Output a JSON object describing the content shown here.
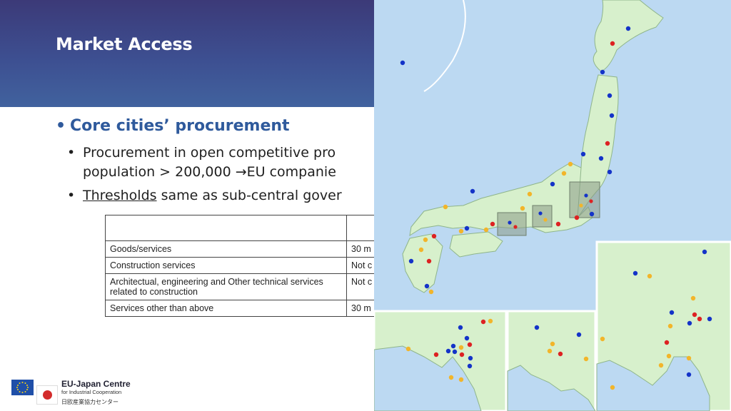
{
  "slide": {
    "title": "Market Access"
  },
  "bullets": {
    "main": "Core cities’ procurement",
    "sub1_line1": "Procurement in open competitive pro",
    "sub1_line2_a": "population > 200,000 ",
    "sub1_arrow": "→",
    "sub1_line2_b": "EU companie",
    "sub2_underlined": "Thresholds",
    "sub2_rest": " same as sub-central gover"
  },
  "table": {
    "header": [
      "",
      ""
    ],
    "rows": [
      {
        "item": "Goods/services",
        "value": "30 m"
      },
      {
        "item": "Construction services",
        "value": "Not c"
      },
      {
        "item": "Architectual, engineering and Other technical services related to construction",
        "value": "Not c"
      },
      {
        "item": "Services other than above",
        "value": "30 m"
      }
    ]
  },
  "logo": {
    "name": "EU-Japan Centre",
    "subtitle": "for Industrial Cooperation",
    "japanese": "日欧産業協力センター"
  },
  "colors": {
    "header_top": "#3c3a78",
    "header_bottom": "#41629e",
    "bullet_blue": "#2f5a9c",
    "sea": "#bcd9f2",
    "land": "#d7f0cc",
    "dot_blue": "#1433c8",
    "dot_red": "#dd2222",
    "dot_yellow": "#f2b52a"
  }
}
